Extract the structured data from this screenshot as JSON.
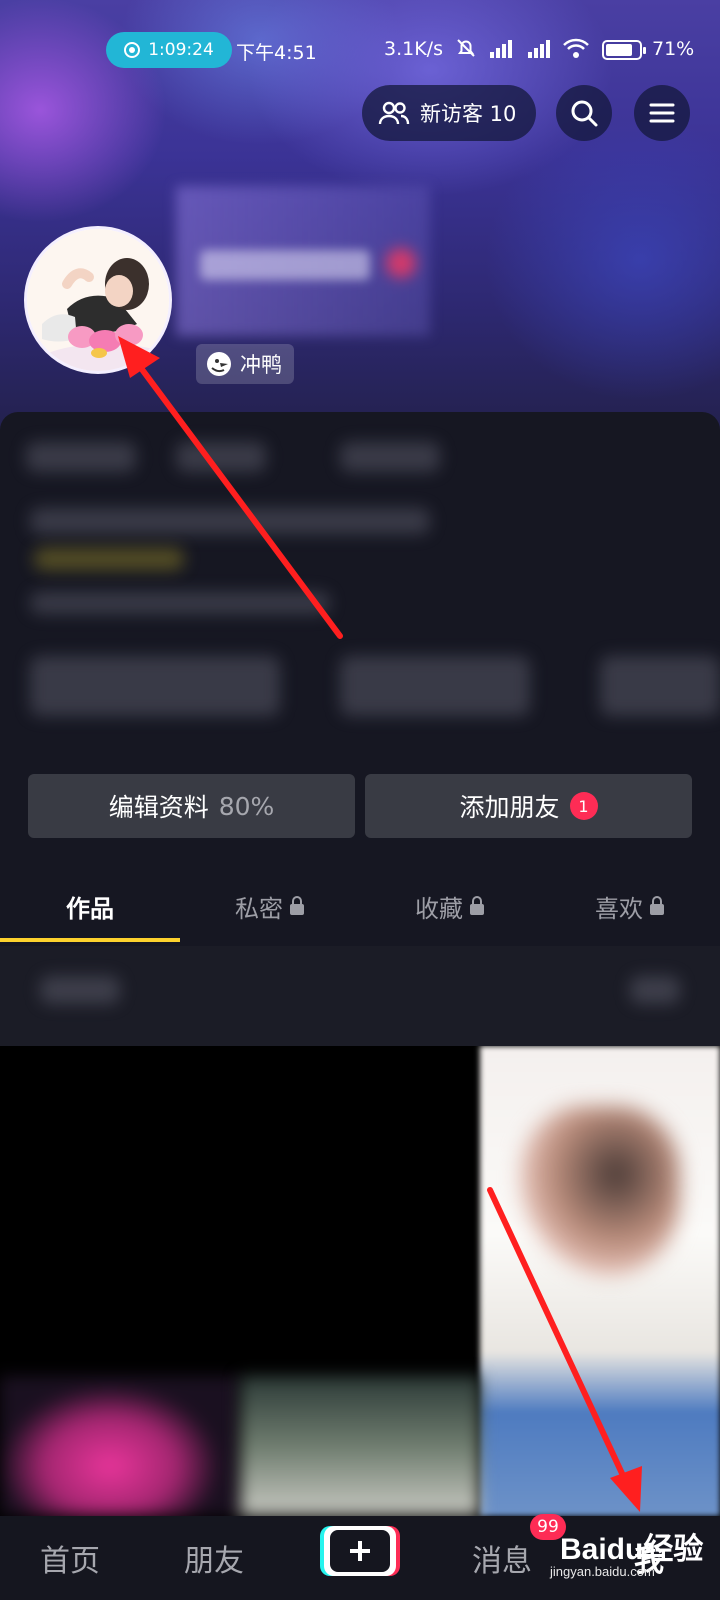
{
  "status_bar": {
    "recording_time": "1:09:24",
    "time": "下午4:51",
    "net_speed": "3.1K/s",
    "battery": "71%"
  },
  "header": {
    "visitors_label": "新访客 10",
    "search_icon": "search-icon",
    "menu_icon": "menu-icon"
  },
  "profile": {
    "badge_label": "冲鸭"
  },
  "actions": {
    "edit_label": "编辑资料",
    "edit_progress": "80%",
    "add_friend_label": "添加朋友",
    "add_friend_badge": "1"
  },
  "tabs": [
    {
      "label": "作品",
      "locked": false
    },
    {
      "label": "私密",
      "locked": true
    },
    {
      "label": "收藏",
      "locked": true
    },
    {
      "label": "喜欢",
      "locked": true
    }
  ],
  "bottom_nav": {
    "home": "首页",
    "friends": "朋友",
    "messages": "消息",
    "messages_badge": "99",
    "me": "我"
  },
  "watermark": {
    "brand": "Baidu经验",
    "url": "jingyan.baidu.com"
  },
  "colors": {
    "accent_yellow": "#fdd22d",
    "badge_red": "#fe2c55",
    "record_pill": "#22b6d6",
    "annotation_arrow": "#ff1f1f"
  }
}
